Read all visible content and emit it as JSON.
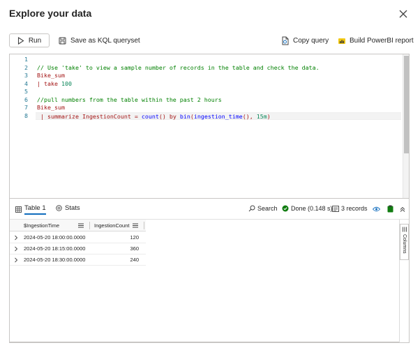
{
  "dialog": {
    "title": "Explore your data",
    "close_icon": "close-icon"
  },
  "toolbar": {
    "run_label": "Run",
    "save_label": "Save as KQL queryset",
    "copy_label": "Copy query",
    "powerbi_label": "Build PowerBI report"
  },
  "editor": {
    "line_numbers": [
      "1",
      "2",
      "3",
      "4",
      "5",
      "6",
      "7",
      "8"
    ],
    "lines": {
      "l2": "// Use 'take' to view a sample number of records in the table and check the data.",
      "l3": "Bike_sum",
      "l4_pipe": "| ",
      "l4_kw": "take ",
      "l4_num": "100",
      "l6": "//pull numbers from the table within the past 2 hours",
      "l7": "Bike_sum",
      "l8_pipe": " | ",
      "l8_kw": "summarize IngestionCount = ",
      "l8_fn1": "count",
      "l8_mid": "() by ",
      "l8_fn2": "bin",
      "l8_arg1": "(",
      "l8_fn3": "ingestion_time",
      "l8_arg2": "(), ",
      "l8_num": "15m",
      "l8_end": ")"
    }
  },
  "results": {
    "tabs": [
      {
        "label": "Table 1",
        "icon": "table-icon",
        "selected": true
      },
      {
        "label": "Stats",
        "icon": "stats-icon",
        "selected": false
      }
    ],
    "search_label": "Search",
    "status_label": "Done (0.148 s)",
    "records_label": "3 records",
    "columns": [
      "$IngestionTime",
      "IngestionCount"
    ],
    "rows": [
      {
        "time": "2024-05-20 18:00:00.0000",
        "count": "120"
      },
      {
        "time": "2024-05-20 18:15:00.0000",
        "count": "360"
      },
      {
        "time": "2024-05-20 18:30:00.0000",
        "count": "240"
      }
    ],
    "side_panel_label": "Columns"
  },
  "colors": {
    "accent": "#0f6cbd",
    "success": "#107c10",
    "comment": "#008000",
    "table_name": "#a31515"
  }
}
